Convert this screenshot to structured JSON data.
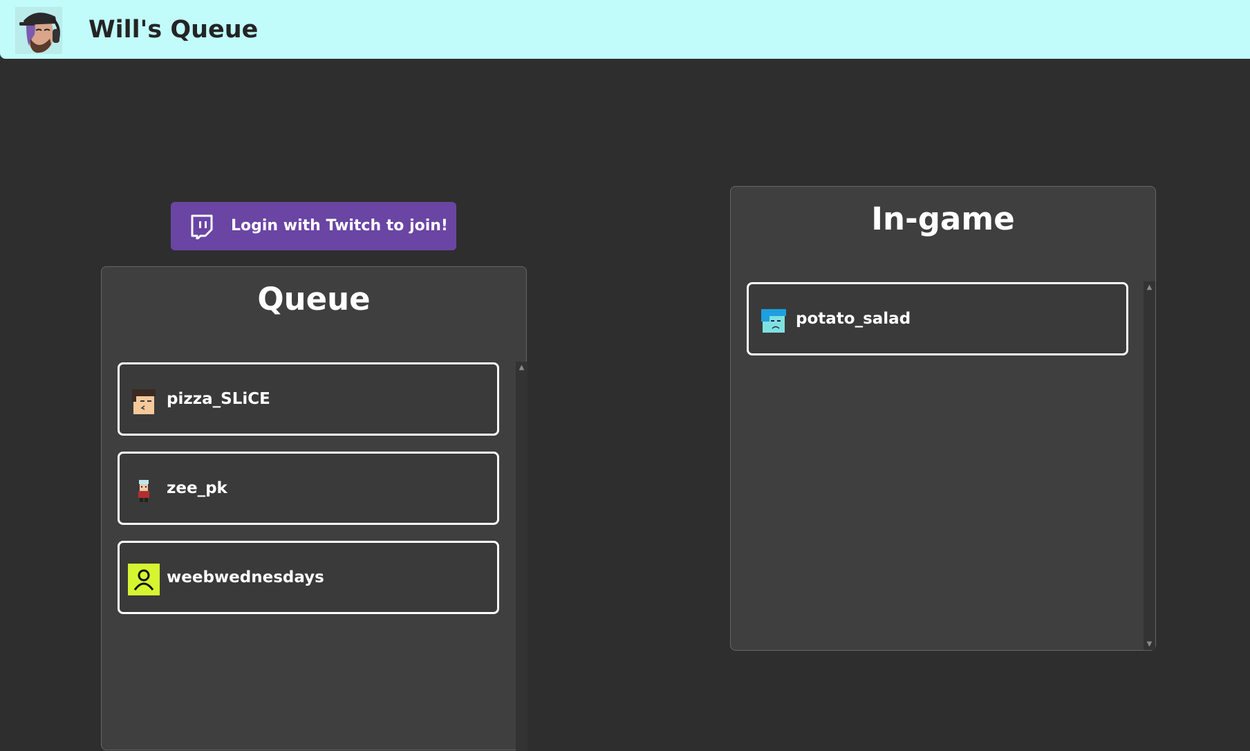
{
  "header": {
    "title": "Will's Queue",
    "logo_icon": "bearded-headphones-avatar-icon",
    "background": "#c1fcfa"
  },
  "login": {
    "label": "Login with Twitch to join!",
    "icon": "twitch-icon",
    "color": "#6a45a4"
  },
  "queue": {
    "title": "Queue",
    "users": [
      {
        "name": "pizza_SLiCE",
        "avatar": "pixel-face-avatar"
      },
      {
        "name": "zee_pk",
        "avatar": "pixel-character-avatar"
      },
      {
        "name": "weebwednesdays",
        "avatar": "default-user-avatar"
      }
    ]
  },
  "ingame": {
    "title": "In-game",
    "users": [
      {
        "name": "potato_salad",
        "avatar": "pixel-blue-face-avatar"
      }
    ]
  }
}
